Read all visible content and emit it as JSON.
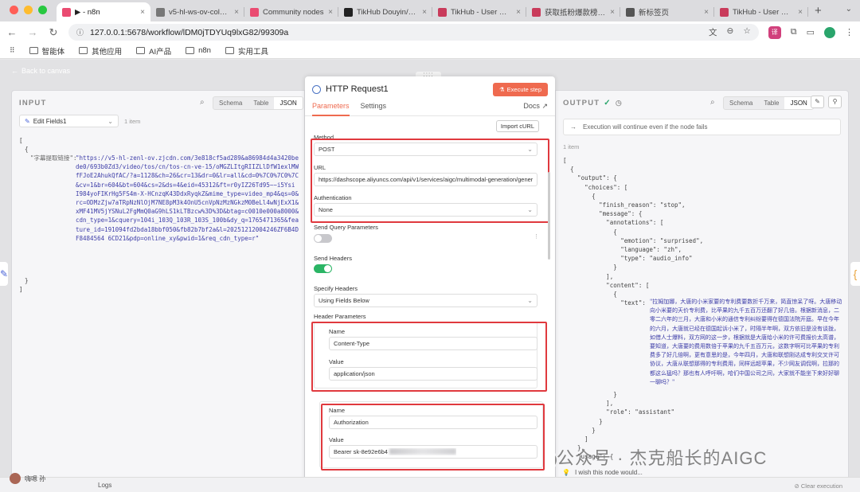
{
  "browser": {
    "tabs": [
      {
        "label": "▶ - n8n",
        "icon": "n8n-logo-icon",
        "color": "#ea4b71",
        "active": true
      },
      {
        "label": "v5-hl-ws-ov-coldy.z",
        "icon": "globe-icon",
        "color": "#777777",
        "active": false
      },
      {
        "label": "Community nodes",
        "icon": "n8n-logo-icon",
        "color": "#ea4b71",
        "active": false
      },
      {
        "label": "TikHub Douyin/TikTo",
        "icon": "tikhub-icon",
        "color": "#222222",
        "active": false
      },
      {
        "label": "TikHub - User Dashb",
        "icon": "tikhub-icon",
        "color": "#c93b5b",
        "active": false
      },
      {
        "label": "获取抵粉爆款榜/Fetc",
        "icon": "tikhub-icon",
        "color": "#c93b5b",
        "active": false
      },
      {
        "label": "新标签页",
        "icon": "chrome-icon",
        "color": "#555555",
        "active": false
      },
      {
        "label": "TikHub - User Dashb",
        "icon": "tikhub-icon",
        "color": "#c93b5b",
        "active": false
      }
    ],
    "url": "127.0.0.1:5678/workflow/lDM0jTDYUq9lxG82/99309a",
    "bookmarks": [
      "智能体",
      "其他应用",
      "AI产品",
      "n8n",
      "实用工具"
    ]
  },
  "canvas": {
    "back_label": "Back to canvas",
    "handle": "::::"
  },
  "input": {
    "title": "INPUT",
    "modes": [
      "Schema",
      "Table",
      "JSON"
    ],
    "active_mode": "JSON",
    "source_node": "Edit Fields1",
    "item_count": "1 item",
    "json_open": "[",
    "obj_open": "{",
    "key": "\"字幕提取链接\":",
    "value": "\"https://v5-hl-zenl-ov.zjcdn.com/3e818cf5ad289&a86984d4a3420bede0/693b0Zd3/video/tos/cn/tos-cn-ve-15/oMGZLItgRIIZLlDfW1exlMWfFJoE2AhukQfAC/?a=1128&ch=26&cr=13&dr=0&lr=all&cd=0%7C0%7C0%7C&cv=1&br=604&bt=604&cs=2&ds=4&eid=45312&ft=r0yIZ26Td95~~i5Ysi I984yoFIKrHg5FS4m-X-HCnzqK43DdxRyqkZ&mime_type=video_mp4&qs=0&rc=ODMzZjw7aTRpNzNlOjM7NE8pM3k4OnU5cnVpNzMzNGkzM0BeLl4wNjExX1&xMF41MV5jYSNuL2FgMmQ0aG9hLS1kLTBzcw%3D%3D&btag=c0010e000a8000&cdn_type=1&cquery=104i_103Q_103R_103S_100b&dy_q=1765471365&feature_id=191094fd2bda18bbf050&fb82b7bf2a&l=20251212004246ZF6B4DF8484564 6CD21&pdp=online_xy&pwid=1&req_cdn_type=r\"",
    "obj_close": "}",
    "json_close": "]"
  },
  "node": {
    "title": "HTTP Request1",
    "execute_label": "Execute step",
    "tabs": [
      "Parameters",
      "Settings"
    ],
    "docs_label": "Docs",
    "import_label": "Import cURL",
    "method_label": "Method",
    "method_value": "POST",
    "url_label": "URL",
    "url_value": "https://dashscope.aliyuncs.com/api/v1/services/aigc/multimodal-generation/generat",
    "auth_label": "Authentication",
    "auth_value": "None",
    "send_query_label": "Send Query Parameters",
    "send_query_on": false,
    "send_headers_label": "Send Headers",
    "send_headers_on": true,
    "specify_headers_label": "Specify Headers",
    "specify_headers_value": "Using Fields Below",
    "header_params_label": "Header Parameters",
    "headers": [
      {
        "name_label": "Name",
        "name": "Content-Type",
        "value_label": "Value",
        "value": "application/json"
      },
      {
        "name_label": "Name",
        "name": "Authorization",
        "value_label": "Value",
        "value": "Bearer sk-8e92e6b4"
      }
    ]
  },
  "output": {
    "title": "OUTPUT",
    "modes": [
      "Schema",
      "Table",
      "JSON"
    ],
    "active_mode": "JSON",
    "notice": "Execution will continue even if the node fails",
    "item_count": "1 item",
    "lines": [
      "[",
      "  {",
      "    \"output\": {",
      "      \"choices\": [",
      "        {",
      "          \"finish_reason\": \"stop\",",
      "          \"message\": {",
      "            \"annotations\": [",
      "              {",
      "                \"emotion\": \"surprised\",",
      "                \"language\": \"zh\",",
      "                \"type\": \"audio_info\"",
      "              }",
      "            ],",
      "            \"content\": [",
      "              {",
      "                \"text\": "
    ],
    "text_value": "\"拉姆加娜，大唐的小米家要的专利费要数折千万来，简直惊呆了呀。大唐移动向小米要的天价专利费，比苹果的九千五百万还翻了好几倍。根据新消息，二零二六年的三月，大唐和小米的通信专利纠纷要得在德国法院开庭。早在今年的六月，大唐就已经在德国起诉小米了，时隔半年啊，双方依旧是没有谈拢，如借人士爆料，双方网的这一步，根据就是大唐给小米的许可费报价太高谱，要知道，大唐要的费用数倍于苹果的九千五百万元，这数字啊可比苹果的专利费多了好几倍啊，更有意思的是，今年四月，大唐和联想刚达成专利交叉许可协议，大唐从联想那得的专利费用，同样远超苹果，不少网友调侃啊，拉那的都这么猛吗？那也有人呼吁啊，哈们中国公司之间，大家就不能坐下来好好聊一聊吗？\"",
    "tail_lines": [
      "              }",
      "            ],",
      "            \"role\": \"assistant\"",
      "          }",
      "        }",
      "      ]",
      "    },",
      "    \"usage\": {"
    ],
    "wish_label": "I wish this node would..."
  },
  "footer": {
    "logs_label": "Logs",
    "user_name": "嗨嗯 孙",
    "clear_label": "Clear execution"
  },
  "watermark": "公众号 · 杰克船长的AIGC"
}
